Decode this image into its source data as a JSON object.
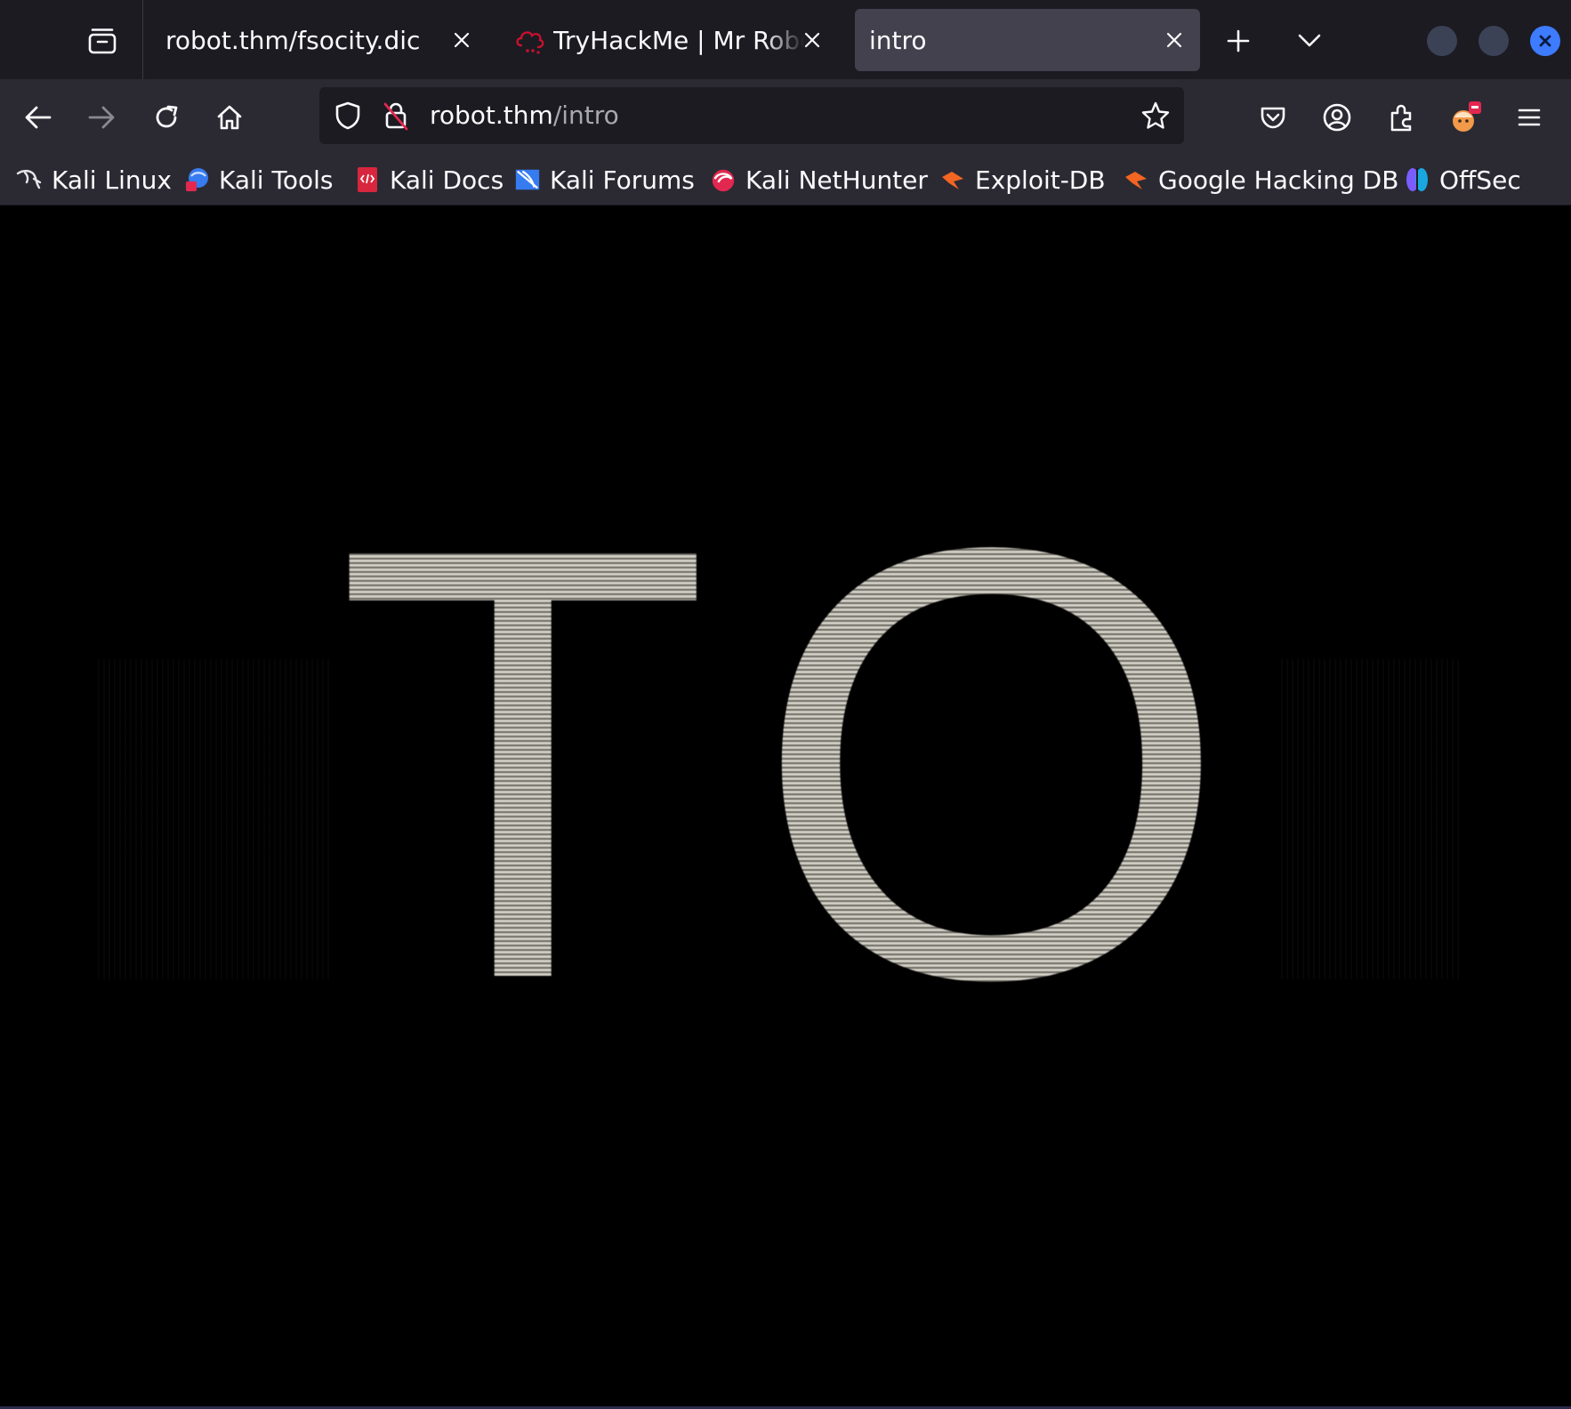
{
  "tabs": [
    {
      "title": "robot.thm/fsocity.dic",
      "active": false
    },
    {
      "title": "TryHackMe | Mr Robot CTF",
      "active": false,
      "favicon": "tryhackme-cloud-icon"
    },
    {
      "title": "intro",
      "active": true
    }
  ],
  "navbar": {
    "url_host": "robot.thm",
    "url_path": "/intro"
  },
  "bookmarks": [
    {
      "label": "Kali Linux",
      "icon": "kali-dragon-icon"
    },
    {
      "label": "Kali Tools",
      "icon": "kali-tools-icon"
    },
    {
      "label": "Kali Docs",
      "icon": "kali-docs-icon"
    },
    {
      "label": "Kali Forums",
      "icon": "kali-forums-icon"
    },
    {
      "label": "Kali NetHunter",
      "icon": "kali-nethunter-icon"
    },
    {
      "label": "Exploit-DB",
      "icon": "exploit-db-icon"
    },
    {
      "label": "Google Hacking DB",
      "icon": "exploit-db-icon"
    },
    {
      "label": "OffSec",
      "icon": "offsec-icon"
    }
  ],
  "content": {
    "video_text": "TO"
  },
  "colors": {
    "tabstrip": "#1c1b22",
    "toolbar": "#2b2a33",
    "active_tab": "#42414d",
    "close_accent": "#3d7bff"
  }
}
